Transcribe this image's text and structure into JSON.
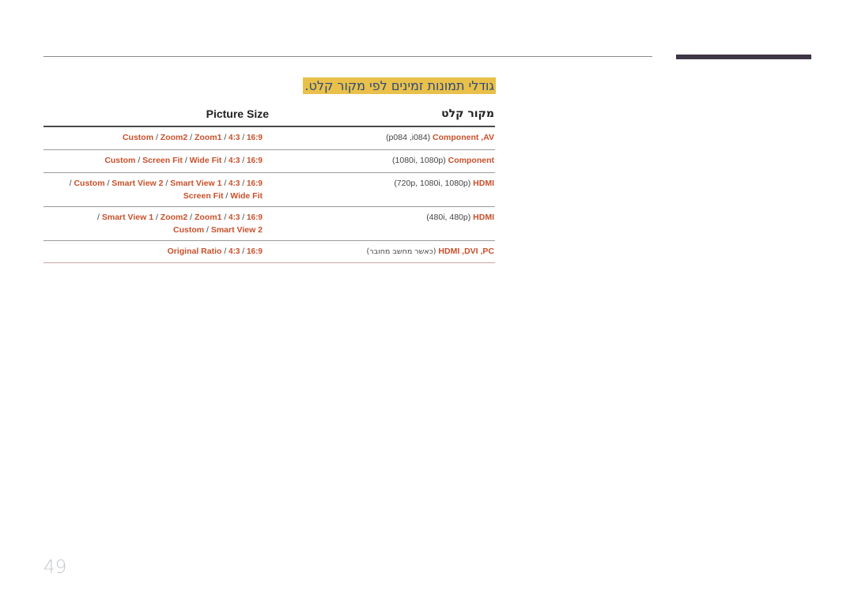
{
  "decorations": {
    "top_bar_color": "#3e3546",
    "heading_highlight_color": "#e8c04a",
    "accent_color": "#c8502a"
  },
  "heading": "גודלי תמונות זמינים לפי מקור קלט.",
  "table": {
    "headers": {
      "picture_size": "Picture Size",
      "input_source": "מקור קלט"
    },
    "rows": [
      {
        "picture_size": "Custom / Zoom2 / Zoom1 / 4:3 / 16:9",
        "picture_size_line2": "",
        "source_detail": "(p084 ,i084)",
        "source_name": "Component ,AV"
      },
      {
        "picture_size": "Custom / Screen Fit / Wide Fit / 4:3 / 16:9",
        "picture_size_line2": "",
        "source_detail": "(1080i, 1080p)",
        "source_name": "Component"
      },
      {
        "picture_size": "/ Custom / Smart View 2 / Smart View 1 / 4:3 / 16:9",
        "picture_size_line2": "Screen Fit / Wide Fit",
        "source_detail": "(720p, 1080i, 1080p)",
        "source_name": "HDMI"
      },
      {
        "picture_size": "/ Smart View 1 / Zoom2 / Zoom1 / 4:3 / 16:9",
        "picture_size_line2": "Custom / Smart View 2",
        "source_detail": "(480i, 480p)",
        "source_name": "HDMI"
      },
      {
        "picture_size": "Original Ratio / 4:3 / 16:9",
        "picture_size_line2": "",
        "source_detail": "(כאשר מחשב מחובר)",
        "source_name": "HDMI ,DVI ,PC"
      }
    ]
  },
  "page_number": "49"
}
